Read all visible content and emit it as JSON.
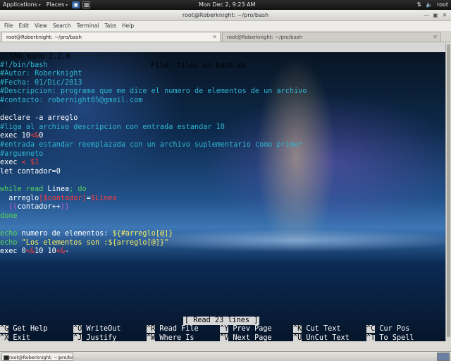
{
  "top_panel": {
    "applications": "Applications",
    "places": "Places",
    "clock": "Mon Dec  2,  9:23 AM",
    "user": "root"
  },
  "window": {
    "title": "root@Roberknight: ~/pro/bash",
    "menu": [
      "File",
      "Edit",
      "View",
      "Search",
      "Terminal",
      "Tabs",
      "Help"
    ],
    "tabs": [
      {
        "label": "root@Roberknight: ~/pro/bash",
        "active": true
      },
      {
        "label": "root@Roberknight: ~/pro/bash",
        "active": false
      }
    ]
  },
  "nano": {
    "version": "GNU nano 2.2.6",
    "file": "File: files en bash.sh",
    "status": "[ Read 23 lines ]",
    "shortcuts": [
      [
        {
          "key": "^G",
          "label": "Get Help"
        },
        {
          "key": "^O",
          "label": "WriteOut"
        },
        {
          "key": "^R",
          "label": "Read File"
        },
        {
          "key": "^Y",
          "label": "Prev Page"
        },
        {
          "key": "^K",
          "label": "Cut Text"
        },
        {
          "key": "^C",
          "label": "Cur Pos"
        }
      ],
      [
        {
          "key": "^X",
          "label": "Exit"
        },
        {
          "key": "^J",
          "label": "Justify"
        },
        {
          "key": "^W",
          "label": "Where Is"
        },
        {
          "key": "^V",
          "label": "Next Page"
        },
        {
          "key": "^U",
          "label": "UnCut Text"
        },
        {
          "key": "^T",
          "label": "To Spell"
        }
      ]
    ]
  },
  "code": [
    [],
    [
      {
        "t": "#!/bin/bash",
        "c": "comment"
      }
    ],
    [
      {
        "t": "#Autor: Roberknight",
        "c": "comment"
      }
    ],
    [
      {
        "t": "#Fecha: 01/Dic/2013",
        "c": "comment"
      }
    ],
    [
      {
        "t": "#Descripcion: programa que me dice el numero de elementos de un archivo",
        "c": "comment"
      }
    ],
    [
      {
        "t": "#contacto: robernight05@gmail.com",
        "c": "comment"
      }
    ],
    [],
    [
      {
        "t": "declare -a arreglo",
        "c": "white"
      }
    ],
    [
      {
        "t": "#liga al archivo descripcion con entrada estandar 10",
        "c": "comment"
      }
    ],
    [
      {
        "t": "exec 10",
        "c": "white"
      },
      {
        "t": "<&",
        "c": "red"
      },
      {
        "t": "0",
        "c": "white"
      }
    ],
    [
      {
        "t": "#entrada estandar reemplazada con un archivo suplementario como primer",
        "c": "comment"
      }
    ],
    [
      {
        "t": "#argumneto",
        "c": "comment"
      }
    ],
    [
      {
        "t": "exec ",
        "c": "white"
      },
      {
        "t": "<",
        "c": "red"
      },
      {
        "t": " ",
        "c": "white"
      },
      {
        "t": "$1",
        "c": "red"
      }
    ],
    [
      {
        "t": "let contador=0",
        "c": "white"
      }
    ],
    [],
    [
      {
        "t": "while read ",
        "c": "green"
      },
      {
        "t": "Linea",
        "c": "white"
      },
      {
        "t": "; do",
        "c": "green"
      }
    ],
    [
      {
        "t": "  arreglo",
        "c": "white"
      },
      {
        "t": "[$contador]",
        "c": "red"
      },
      {
        "t": "=",
        "c": "white"
      },
      {
        "t": "$Linea",
        "c": "red"
      }
    ],
    [
      {
        "t": "  ((",
        "c": "magenta"
      },
      {
        "t": "contador++",
        "c": "white"
      },
      {
        "t": "))",
        "c": "magenta"
      }
    ],
    [
      {
        "t": "done",
        "c": "green"
      }
    ],
    [],
    [
      {
        "t": "echo ",
        "c": "green"
      },
      {
        "t": "numero de elementos: ",
        "c": "white"
      },
      {
        "t": "${#arreglo[@]}",
        "c": "yellow"
      }
    ],
    [
      {
        "t": "echo ",
        "c": "green"
      },
      {
        "t": "\"Los elementos son :${arreglo[@]}\"",
        "c": "yellow"
      }
    ],
    [
      {
        "t": "exec 0",
        "c": "white"
      },
      {
        "t": "<&",
        "c": "red"
      },
      {
        "t": "10 10",
        "c": "white"
      },
      {
        "t": "<&",
        "c": "red"
      },
      {
        "t": "-",
        "c": "white"
      }
    ]
  ]
}
